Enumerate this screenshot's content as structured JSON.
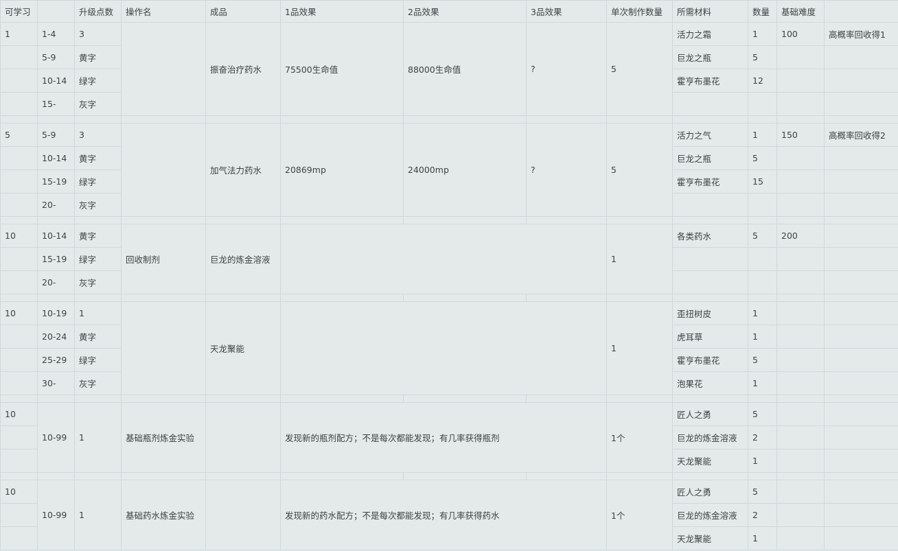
{
  "headers": [
    "可学习",
    "",
    "升级点数",
    "操作名",
    "成品",
    "1品效果",
    "2品效果",
    "3品效果",
    "单次制作数量",
    "所需材料",
    "数量",
    "基础难度",
    ""
  ],
  "r1": {
    "learn": "1",
    "ranges": [
      "1-4",
      "5-9",
      "10-14",
      "15-"
    ],
    "points": [
      "3",
      "黄字",
      "绿字",
      "灰字"
    ],
    "op": "",
    "product": "振奋治疗药水",
    "q1": "75500生命值",
    "q2": "88000生命值",
    "q3": "?",
    "count": "5",
    "materials": [
      "活力之霜",
      "巨龙之瓶",
      "霍亨布墨花",
      ""
    ],
    "qty": [
      "1",
      "5",
      "12",
      ""
    ],
    "diff": "100",
    "note": "高概率回收得1"
  },
  "r2": {
    "learn": "5",
    "ranges": [
      "5-9",
      "10-14",
      "15-19",
      "20-"
    ],
    "points": [
      "3",
      "黄字",
      "绿字",
      "灰字"
    ],
    "op": "",
    "product": "加气法力药水",
    "q1": "20869mp",
    "q2": "24000mp",
    "q3": "?",
    "count": "5",
    "materials": [
      "活力之气",
      "巨龙之瓶",
      "霍亨布墨花",
      ""
    ],
    "qty": [
      "1",
      "5",
      "15",
      ""
    ],
    "diff": "150",
    "note": "高概率回收得2"
  },
  "r3": {
    "learn": "10",
    "ranges": [
      "10-14",
      "15-19",
      "20-"
    ],
    "points": [
      "黄字",
      "绿字",
      "灰字"
    ],
    "op": "回收制剂",
    "product": "巨龙的炼金溶液",
    "count": "1",
    "materials": [
      "各类药水",
      "",
      ""
    ],
    "qty": [
      "5",
      "",
      ""
    ],
    "diff": "200"
  },
  "r4": {
    "learn": "10",
    "ranges": [
      "10-19",
      "20-24",
      "25-29",
      "30-"
    ],
    "points": [
      "1",
      "黄字",
      "绿字",
      "灰字"
    ],
    "op": "",
    "product": "天龙聚能",
    "count": "1",
    "materials": [
      "歪扭树皮",
      "虎耳草",
      "霍亨布墨花",
      "泡果花"
    ],
    "qty": [
      "1",
      "1",
      "5",
      "1"
    ]
  },
  "r5": {
    "learn": "10",
    "range": "10-99",
    "points": "1",
    "op": "基础瓶剂炼金实验",
    "desc": "发现新的瓶剂配方；不是每次都能发现；有几率获得瓶剂",
    "count": "1个",
    "materials": [
      "匠人之勇",
      "巨龙的炼金溶液",
      "天龙聚能"
    ],
    "qty": [
      "5",
      "2",
      "1"
    ]
  },
  "r6": {
    "learn": "10",
    "range": "10-99",
    "points": "1",
    "op": "基础药水炼金实验",
    "desc": "发现新的药水配方；不是每次都能发现；有几率获得药水",
    "count": "1个",
    "materials": [
      "匠人之勇",
      "巨龙的炼金溶液",
      "天龙聚能"
    ],
    "qty": [
      "5",
      "2",
      "1"
    ]
  }
}
